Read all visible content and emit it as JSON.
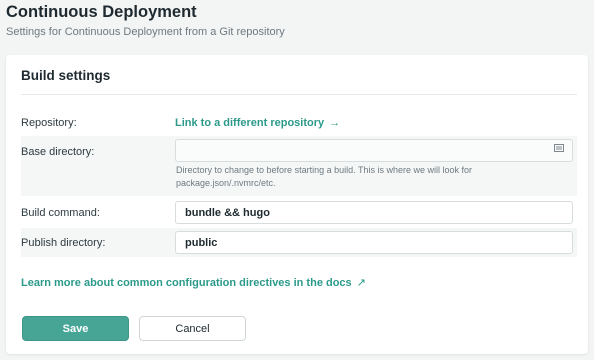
{
  "header": {
    "title": "Continuous Deployment",
    "subtitle": "Settings for Continuous Deployment from a Git repository"
  },
  "build_settings": {
    "title": "Build settings",
    "repository": {
      "label": "Repository:",
      "link_text": "Link to a different repository",
      "link_arrow": "→"
    },
    "base_directory": {
      "label": "Base directory:",
      "value": "",
      "hint": "Directory to change to before starting a build. This is where we will look for package.json/.nvmrc/etc.",
      "icon": "folder-list-icon"
    },
    "build_command": {
      "label": "Build command:",
      "value": "bundle && hugo"
    },
    "publish_directory": {
      "label": "Publish directory:",
      "value": "public"
    },
    "docs_link": {
      "text": "Learn more about common configuration directives in the docs",
      "arrow": "↗"
    },
    "save_label": "Save",
    "cancel_label": "Cancel"
  },
  "colors": {
    "accent": "#2b9a8a",
    "save_button": "#47a596",
    "background": "#f3f4f4"
  }
}
